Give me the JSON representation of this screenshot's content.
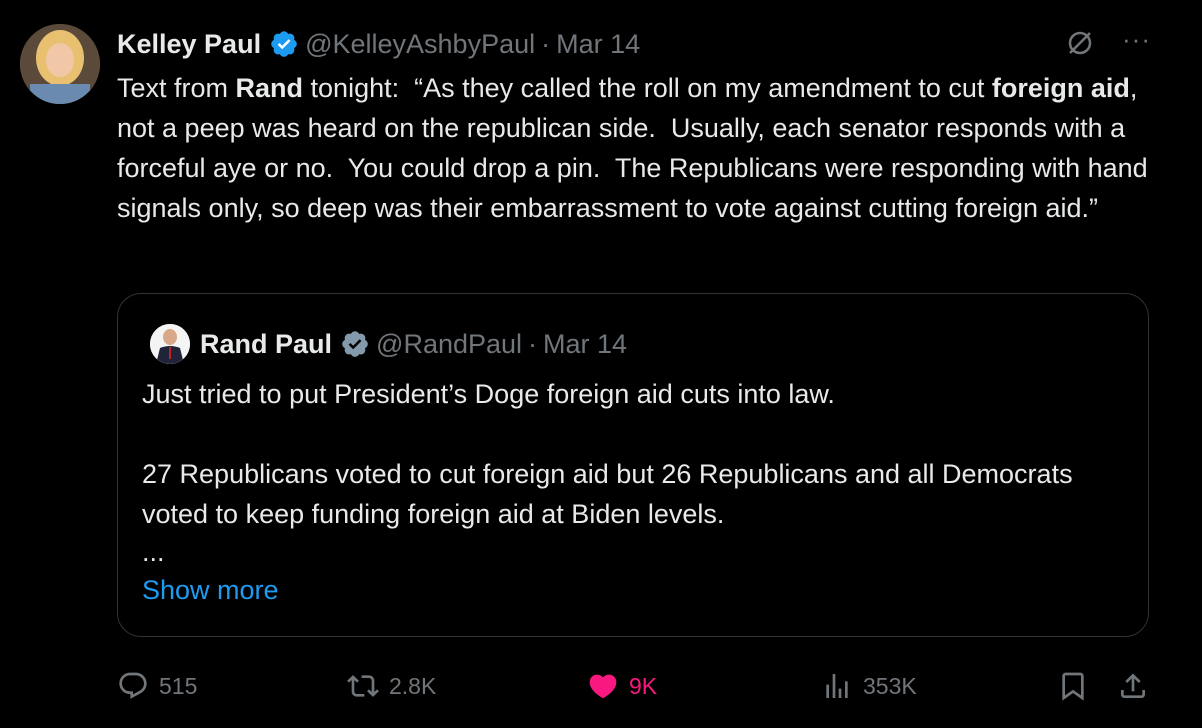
{
  "tweet": {
    "author_name": "Kelley Paul",
    "handle": "@KelleyAshbyPaul",
    "date": "Mar 14",
    "more": "···",
    "text_parts": [
      "Text from ",
      "Rand",
      " tonight:  “As they called the roll on my amendment to cut ",
      "foreign aid",
      ", not a peep was heard on the republican side.  Usually, each senator responds with a forceful aye or no.  You could drop a pin.  The Republicans were responding with hand signals only, so deep was their embarrassment to vote against cutting foreign aid.”"
    ]
  },
  "quoted": {
    "author_name": "Rand Paul",
    "handle": "@RandPaul",
    "date": "Mar 14",
    "line1": "Just tried to put President’s Doge foreign aid cuts into law.",
    "line2": "27 Republicans voted to cut foreign aid but 26 Republicans and all Democrats voted to keep funding foreign aid at Biden levels.",
    "ellipsis": "...",
    "show_more": "Show more"
  },
  "actions": {
    "replies": "515",
    "reposts": "2.8K",
    "likes": "9K",
    "views": "353K"
  },
  "colors": {
    "accent": "#1d9bf0",
    "like": "#f91880",
    "muted": "#71767b",
    "text": "#e7e9ea",
    "border": "#2f3336"
  },
  "icons": [
    "verified-badge-icon",
    "grok-icon",
    "more-icon",
    "reply-icon",
    "repost-icon",
    "like-icon",
    "views-icon",
    "bookmark-icon",
    "share-icon"
  ]
}
